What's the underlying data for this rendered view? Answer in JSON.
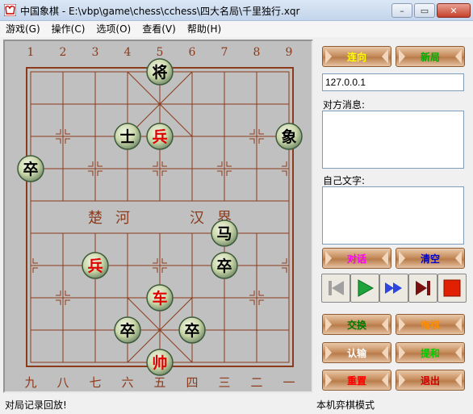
{
  "window": {
    "title": "中国象棋 - E:\\vbp\\game\\chess\\cchess\\四大名局\\千里独行.xqr",
    "minimize": "–",
    "restore": "▭",
    "close": "✕"
  },
  "menu": [
    "游戏(G)",
    "操作(C)",
    "选项(O)",
    "查看(V)",
    "帮助(H)"
  ],
  "board": {
    "top_labels": [
      "1",
      "2",
      "3",
      "4",
      "5",
      "6",
      "7",
      "8",
      "9"
    ],
    "bottom_labels": [
      "九",
      "八",
      "七",
      "六",
      "五",
      "四",
      "三",
      "二",
      "一"
    ],
    "river_left": [
      "楚",
      "河"
    ],
    "river_right": [
      "汉",
      "界"
    ],
    "pieces": [
      {
        "char": "将",
        "color": "black",
        "file": 5,
        "rank": 1
      },
      {
        "char": "士",
        "color": "black",
        "file": 4,
        "rank": 3
      },
      {
        "char": "兵",
        "color": "red",
        "file": 5,
        "rank": 3
      },
      {
        "char": "象",
        "color": "black",
        "file": 9,
        "rank": 3
      },
      {
        "char": "卒",
        "color": "black",
        "file": 1,
        "rank": 4
      },
      {
        "char": "马",
        "color": "black",
        "file": 7,
        "rank": 6
      },
      {
        "char": "兵",
        "color": "red",
        "file": 3,
        "rank": 7
      },
      {
        "char": "卒",
        "color": "black",
        "file": 7,
        "rank": 7
      },
      {
        "char": "车",
        "color": "red",
        "file": 5,
        "rank": 8
      },
      {
        "char": "卒",
        "color": "black",
        "file": 4,
        "rank": 9
      },
      {
        "char": "卒",
        "color": "black",
        "file": 6,
        "rank": 9
      },
      {
        "char": "帅",
        "color": "red",
        "file": 5,
        "rank": 10
      }
    ]
  },
  "panel": {
    "connect_label": "连向",
    "newgame_label": "新局",
    "ip_value": "127.0.0.1",
    "opponent_msg_label": "对方消息:",
    "own_text_label": "自己文字:",
    "chat_label": "对话",
    "clear_label": "清空",
    "swap_label": "交换",
    "undo_label": "悔棋",
    "resign_label": "认输",
    "draw_label": "提和",
    "reset_label": "重置",
    "exit_label": "退出"
  },
  "colors": {
    "board_line": "#8b3a1a",
    "red_piece": "#e00000",
    "black_piece": "#000000",
    "connect": "#ffff00",
    "newgame": "#00aa00",
    "chat": "#ff00ff",
    "clear": "#0000cc",
    "swap": "#007700",
    "undo": "#ff8c00",
    "resign": "#ffffff",
    "draw": "#00cc00",
    "reset": "#ff0000",
    "exit": "#cc0000"
  },
  "status": {
    "left": "对局记录回放!",
    "right": "本机弈棋模式"
  }
}
